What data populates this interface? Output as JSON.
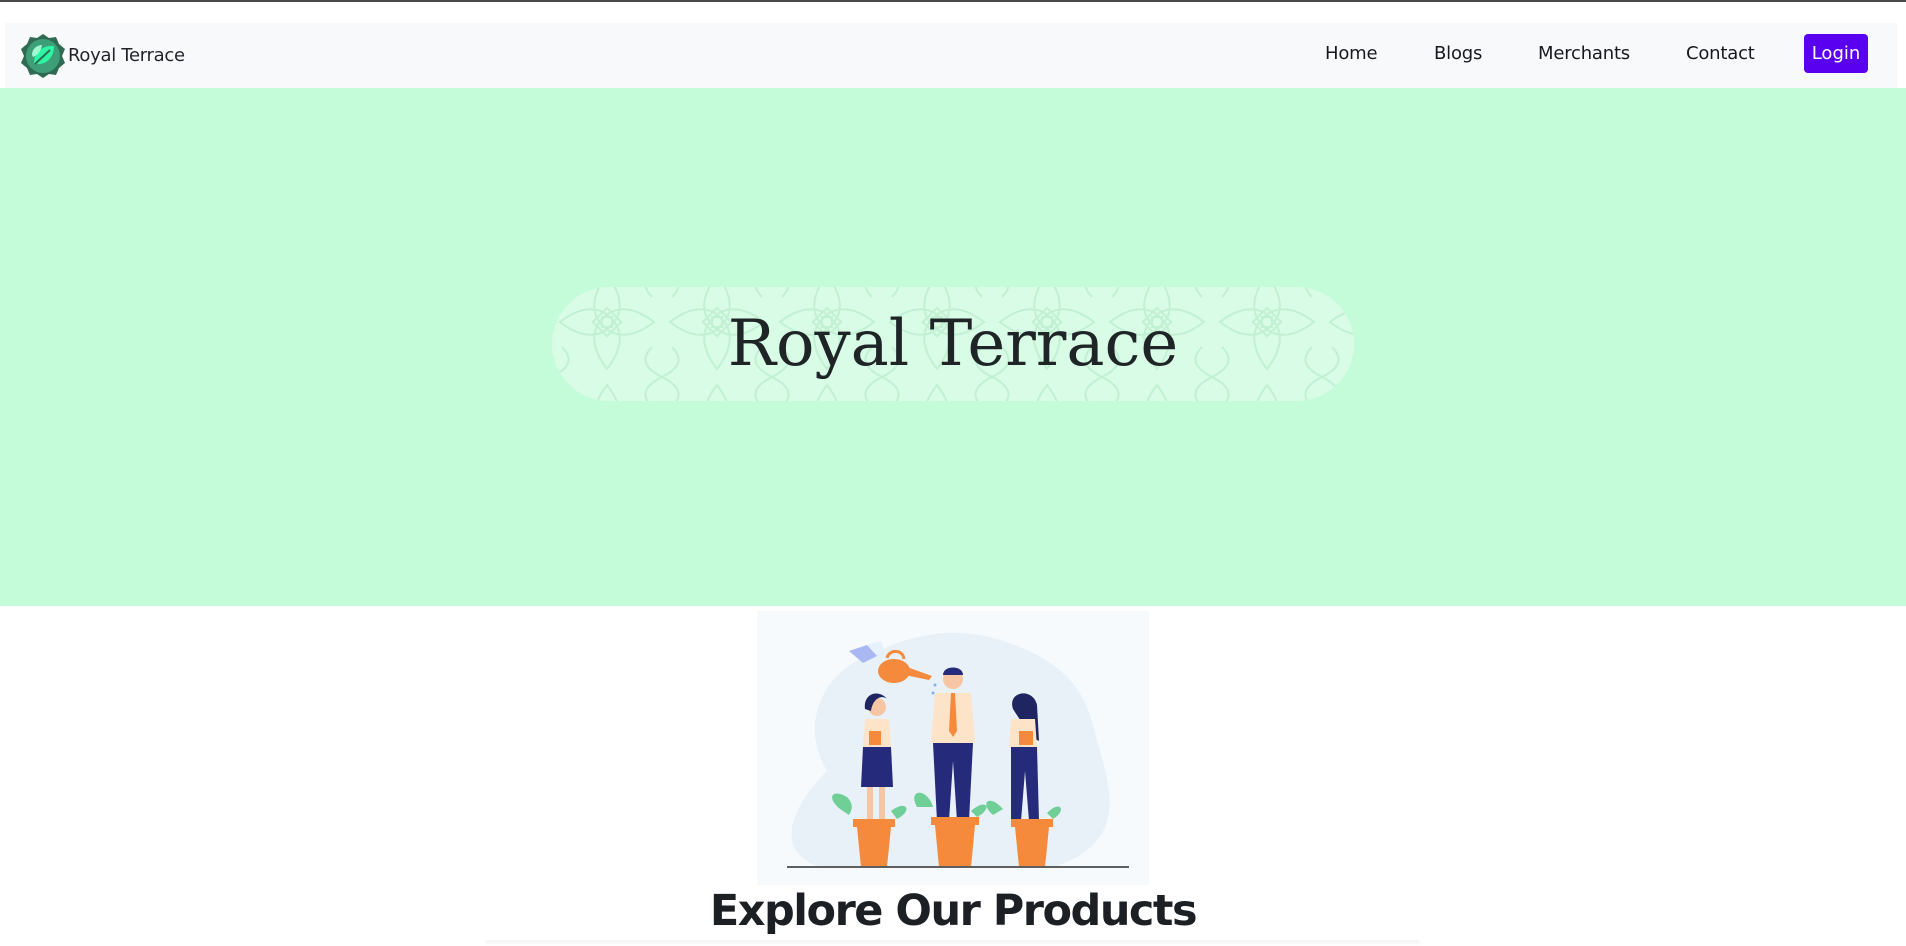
{
  "brand": {
    "name": "Royal Terrace",
    "logo_icon": "leaf-logo-icon"
  },
  "nav": {
    "items": [
      {
        "label": "Home"
      },
      {
        "label": "Blogs"
      },
      {
        "label": "Merchants"
      },
      {
        "label": "Contact"
      }
    ],
    "login_label": "Login"
  },
  "hero": {
    "title": "Royal Terrace"
  },
  "illustration": {
    "name": "people-growing-in-plant-pots-illustration"
  },
  "products": {
    "heading": "Explore Our Products"
  },
  "colors": {
    "hero_background": "#c4fcd9",
    "login_button": "#5a00f0",
    "navbar_background": "#f8f9fb",
    "accent_orange": "#f58a3c",
    "accent_navy": "#262a7a"
  }
}
